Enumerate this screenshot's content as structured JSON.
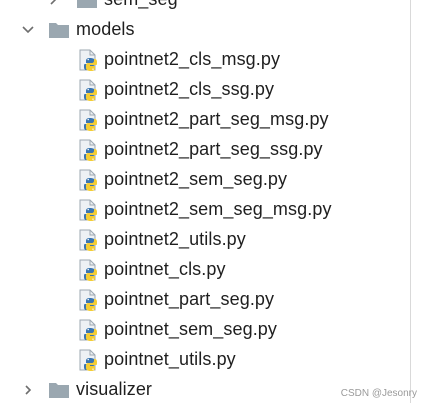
{
  "tree": {
    "top_partial": {
      "label": "sem_seg",
      "icon": "folder-icon"
    },
    "models": {
      "label": "models",
      "expanded": true,
      "icon": "folder-icon",
      "files": [
        "pointnet2_cls_msg.py",
        "pointnet2_cls_ssg.py",
        "pointnet2_part_seg_msg.py",
        "pointnet2_part_seg_ssg.py",
        "pointnet2_sem_seg.py",
        "pointnet2_sem_seg_msg.py",
        "pointnet2_utils.py",
        "pointnet_cls.py",
        "pointnet_part_seg.py",
        "pointnet_sem_seg.py",
        "pointnet_utils.py"
      ],
      "file_icon": "python-file-icon"
    },
    "visualizer": {
      "label": "visualizer",
      "expanded": false,
      "icon": "folder-icon"
    }
  },
  "watermark": "CSDN @Jesonry",
  "colors": {
    "folder": "#9aa7b0",
    "python_blue": "#3a75b0",
    "python_yellow": "#f4cd34",
    "file_doc": "#9ea8b2",
    "chevron": "#6e6e6e"
  }
}
